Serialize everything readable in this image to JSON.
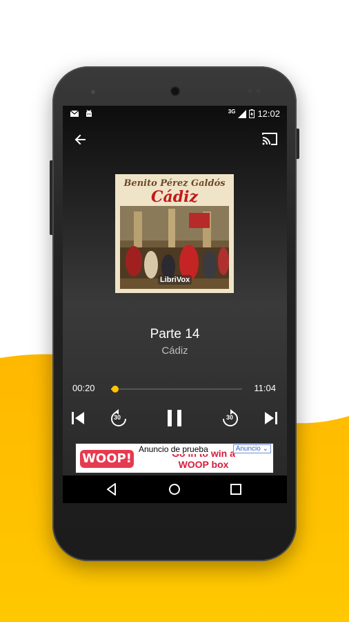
{
  "status_bar": {
    "network": "3G",
    "time": "12:02"
  },
  "toolbar": {
    "back_icon": "arrow-left-icon",
    "cast_icon": "cast-icon"
  },
  "cover": {
    "author": "Benito Pérez Galdós",
    "title": "Cádiz",
    "publisher": "LibriVox"
  },
  "player": {
    "track_title": "Parte 14",
    "book_title": "Cádiz",
    "elapsed": "00:20",
    "duration": "11:04",
    "progress_fraction": 0.03,
    "rewind_seconds": "30",
    "forward_seconds": "30",
    "accent_color": "#ffc400"
  },
  "ad": {
    "label": "Anuncio de prueba",
    "badge": "Anuncio",
    "brand": "WOOP!",
    "text_line1": "Go in to win a",
    "text_line2": "WOOP box"
  },
  "colors": {
    "wave_yellow": "#ffbf00",
    "screen_dark": "#262626"
  }
}
